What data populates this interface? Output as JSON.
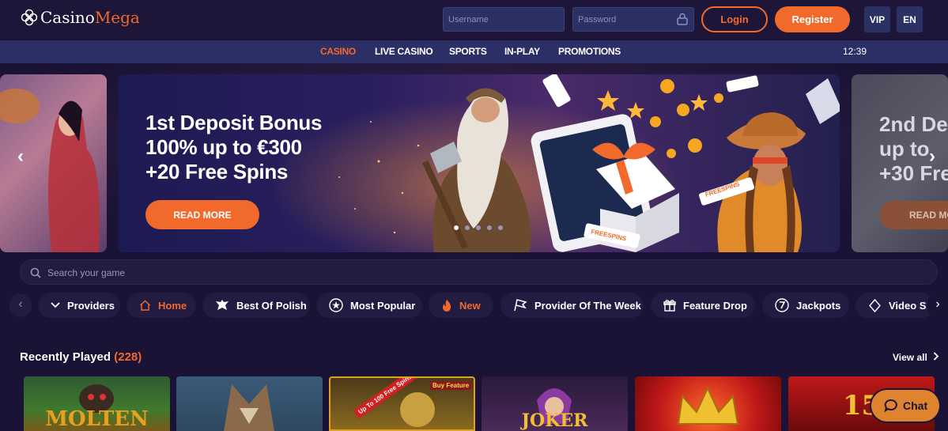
{
  "header": {
    "logo_left": "Casino",
    "logo_right": "Mega",
    "username_placeholder": "Username",
    "password_placeholder": "Password",
    "login_label": "Login",
    "register_label": "Register",
    "vip_label": "VIP",
    "lang_label": "EN"
  },
  "nav": {
    "items": [
      "CASINO",
      "LIVE CASINO",
      "SPORTS",
      "IN-PLAY",
      "PROMOTIONS"
    ],
    "active": "CASINO",
    "clock": "12:39"
  },
  "hero": {
    "line1": "1st Deposit Bonus",
    "line2": "100% up to €300",
    "line3": "+20 Free Spins",
    "button": "READ MORE",
    "badge_freespins": "FREESPINS",
    "dots_count": 5,
    "active_dot": 1,
    "next_slide": {
      "line1": "2nd De",
      "line2": "up to",
      "line3": "+30 Fre",
      "button": "READ MO"
    }
  },
  "search": {
    "placeholder": "Search your game"
  },
  "categories": [
    {
      "label": "Providers",
      "icon": "chevron-down-icon"
    },
    {
      "label": "Home",
      "icon": "home-icon"
    },
    {
      "label": "Best Of Polish",
      "icon": "eagle-icon"
    },
    {
      "label": "Most Popular",
      "icon": "star-badge-icon"
    },
    {
      "label": "New",
      "icon": "fire-icon"
    },
    {
      "label": "Provider Of The Week",
      "icon": "flag-icon"
    },
    {
      "label": "Feature Drop",
      "icon": "gift-icon"
    },
    {
      "label": "Jackpots",
      "icon": "seven-icon"
    },
    {
      "label": "Video Sl",
      "icon": "card-icon"
    }
  ],
  "recently_played": {
    "title": "Recently Played",
    "count": "(228)",
    "view_all": "View all",
    "games": [
      {
        "label": "MOLTEN"
      },
      {
        "label": ""
      },
      {
        "label": "Up To 100 Free Spins",
        "badge": "Buy Feature"
      },
      {
        "label": "JOKER"
      },
      {
        "label": ""
      },
      {
        "label": "15"
      }
    ]
  },
  "chat": {
    "label": "Chat"
  },
  "colors": {
    "accent": "#f26a2b",
    "background": "#1a1335",
    "navbar": "#2b2f66",
    "input": "#2b3163"
  }
}
